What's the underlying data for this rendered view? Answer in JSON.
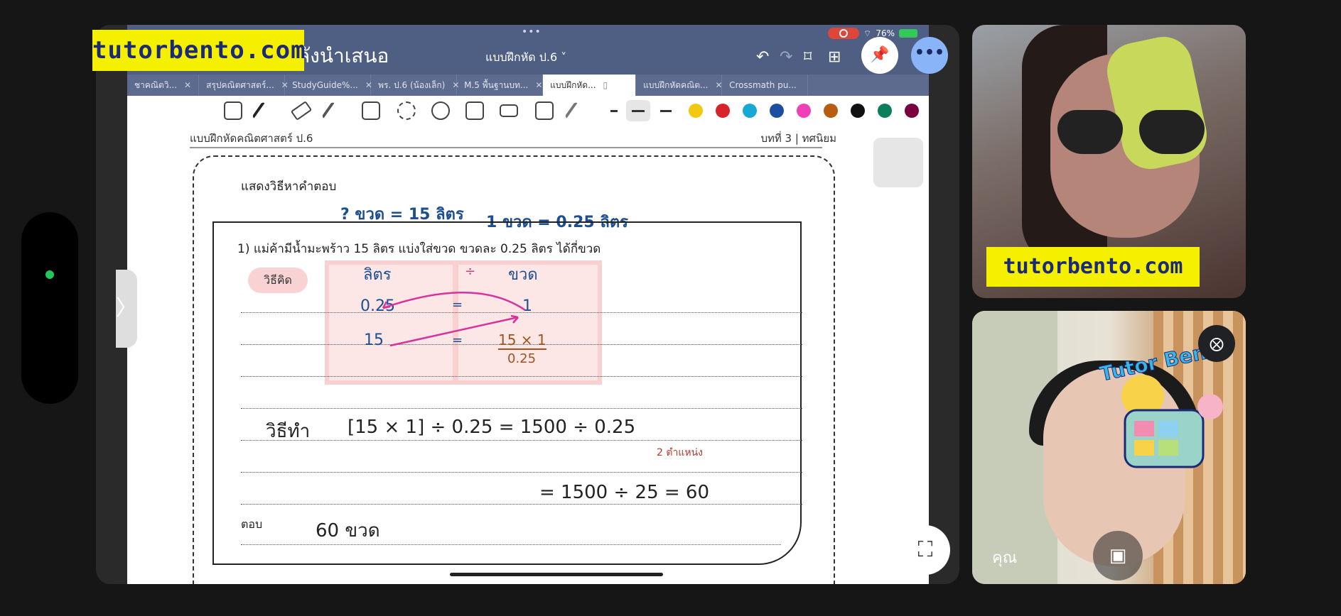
{
  "watermark_text": "tutorbento.com",
  "shared_screen": {
    "present_label": "ลังนำเสนอ",
    "doc_title": "แบบฝึกหัด ป.6 ˅",
    "status": {
      "battery": "76%"
    },
    "top_dots": "•••",
    "tabs": [
      {
        "label": "ชาคณิตวิ...",
        "active": false
      },
      {
        "label": "สรุปคณิตศาสตร์...",
        "active": false
      },
      {
        "label": "StudyGuide%...",
        "active": false
      },
      {
        "label": "พร. ป.6 (น้องเล็ก)",
        "active": false
      },
      {
        "label": "M.5 พื้นฐานบท...",
        "active": false
      },
      {
        "label": "แบบฝึกหัด...",
        "active": true
      },
      {
        "label": "แบบฝึกหัดคณิต...",
        "active": false
      },
      {
        "label": "Crossmath pu...",
        "active": false
      }
    ],
    "colors": [
      "#f2c811",
      "#d8232a",
      "#16a9d6",
      "#1c4fa0",
      "#f040b8",
      "#b85c10",
      "#111111",
      "#0a7f5c",
      "#7a0040"
    ],
    "page": {
      "header_left": "แบบฝึกหัดคณิตศาสตร์ ป.6",
      "header_right": "บทที่ 3 | ทศนิยม",
      "show_method": "แสดงวิธีหาคำตอบ",
      "annotation_q": "? ขวด = 15 ลิตร",
      "annotation_a": "1 ขวด = 0.25 ลิตร",
      "question": "1)   แม่ค้ามีน้ำมะพร้าว 15 ลิตร แบ่งใส่ขวด ขวดละ 0.25 ลิตร ได้กี่ขวด",
      "think_label": "วิธีคิด",
      "table": {
        "head_left": "ลิตร",
        "op": "÷",
        "head_right": "ขวด",
        "r1_left": "0.25",
        "r1_eq": "=",
        "r1_right": "1",
        "r2_left": "15",
        "r2_eq": "=",
        "r2_right_num": "15 × 1",
        "r2_right_den": "0.25"
      },
      "method_label": "วิธีทำ",
      "work_line1": "[15 × 1] ÷ 0.25   =   1500 ÷ 0.25",
      "work_note": "2 ตำแหน่ง",
      "work_line2": "=   1500 ÷ 25   =   60",
      "answer_label": "ตอบ",
      "answer_value": "60  ขวด"
    }
  },
  "tiles": [
    {
      "name": "remote-participant"
    },
    {
      "name": "self",
      "label": "คุณ"
    }
  ]
}
